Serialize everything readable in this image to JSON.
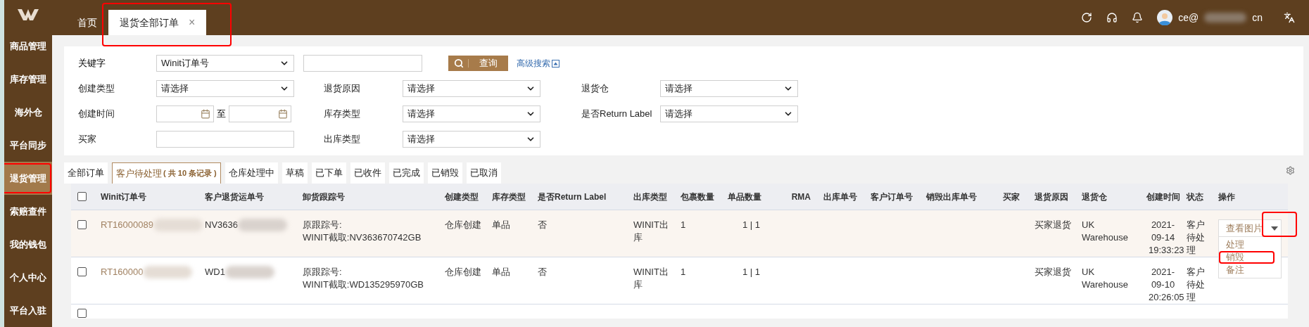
{
  "top_tabs": [
    {
      "label": "首页",
      "selected": false,
      "closable": false,
      "highlighted": false
    },
    {
      "label": "退货全部订单",
      "selected": true,
      "closable": true,
      "highlighted": true
    }
  ],
  "close_glyph": "×",
  "user": {
    "email_start": "ce@",
    "email_end": "cn"
  },
  "sidebar": [
    {
      "label": "商品管理",
      "selected": false,
      "highlighted": false
    },
    {
      "label": "库存管理",
      "selected": false,
      "highlighted": false
    },
    {
      "label": "海外仓",
      "selected": false,
      "highlighted": false
    },
    {
      "label": "平台同步",
      "selected": false,
      "highlighted": false
    },
    {
      "label": "退货管理",
      "selected": true,
      "highlighted": true
    },
    {
      "label": "索赔查件",
      "selected": false,
      "highlighted": false
    },
    {
      "label": "我的钱包",
      "selected": false,
      "highlighted": false
    },
    {
      "label": "个人中心",
      "selected": false,
      "highlighted": false
    },
    {
      "label": "平台入驻",
      "selected": false,
      "highlighted": false
    }
  ],
  "filters": {
    "keyword_label": "关键字",
    "keyword_type": "Winit订单号",
    "search_button": "查询",
    "advanced_search": "高级搜索",
    "date_separator": "至",
    "rows": [
      [
        {
          "kind": "select",
          "label": "创建类型",
          "value": "请选择"
        },
        {
          "kind": "select",
          "label": "退货原因",
          "value": "请选择"
        },
        {
          "kind": "select",
          "label": "退货仓",
          "value": "请选择"
        }
      ],
      [
        {
          "kind": "date",
          "label": "创建时间"
        },
        {
          "kind": "select",
          "label": "库存类型",
          "value": "请选择"
        },
        {
          "kind": "select",
          "label": "是否Return Label",
          "value": "请选择"
        }
      ],
      [
        {
          "kind": "text",
          "label": "买家"
        },
        {
          "kind": "select",
          "label": "出库类型",
          "value": "请选择"
        }
      ]
    ]
  },
  "status_tabs": [
    {
      "label": "全部订单",
      "selected": false
    },
    {
      "label": "客户待处理",
      "count": "( 共 10 条记录 )",
      "selected": true
    },
    {
      "label": "仓库处理中",
      "selected": false
    },
    {
      "label": "草稿",
      "selected": false
    },
    {
      "label": "已下单",
      "selected": false
    },
    {
      "label": "已收件",
      "selected": false
    },
    {
      "label": "已完成",
      "selected": false
    },
    {
      "label": "已销毁",
      "selected": false
    },
    {
      "label": "已取消",
      "selected": false
    }
  ],
  "table": {
    "select_all_checked": false,
    "next_row_checked": false,
    "columns": [
      "Winit订单号",
      "客户退货运单号",
      "卸货跟踪号",
      "创建类型",
      "库存类型",
      "是否Return Label",
      "出库类型",
      "包裹数量",
      "单品数量",
      "RMA",
      "出库单号",
      "客户订单号",
      "销毁出库单号",
      "买家",
      "退货原因",
      "退货仓",
      "创建时间",
      "状态",
      "操作"
    ],
    "rows": [
      {
        "checked": false,
        "order_no": "RT16000089",
        "waybill": "NV3636",
        "tracking": [
          "原跟踪号:",
          "WINIT截取:NV363670742GB"
        ],
        "create_type": "仓库创建",
        "stock_type": "单品",
        "return_label": "否",
        "outbound_type": "WINIT出库",
        "packages": "1",
        "items": "1 | 1",
        "reason": "买家退货",
        "warehouse": "UK Warehouse",
        "created": "2021-09-14 19:33:23",
        "status": "客户待处理",
        "action": "查看图片",
        "caret_highlighted": true,
        "menu": [
          {
            "label": "处理",
            "highlighted": false
          },
          {
            "label": "销毁",
            "highlighted": true
          },
          {
            "label": "备注",
            "highlighted": false
          }
        ]
      },
      {
        "checked": false,
        "order_no": "RT160000",
        "waybill": "WD1",
        "tracking": [
          "原跟踪号:",
          "WINIT截取:WD135295970GB"
        ],
        "create_type": "仓库创建",
        "stock_type": "单品",
        "return_label": "否",
        "outbound_type": "WINIT出库",
        "packages": "1",
        "items": "1 | 1",
        "reason": "买家退货",
        "warehouse": "UK Warehouse",
        "created": "2021-09-10 20:26:05",
        "status": "客户待处理"
      }
    ]
  }
}
